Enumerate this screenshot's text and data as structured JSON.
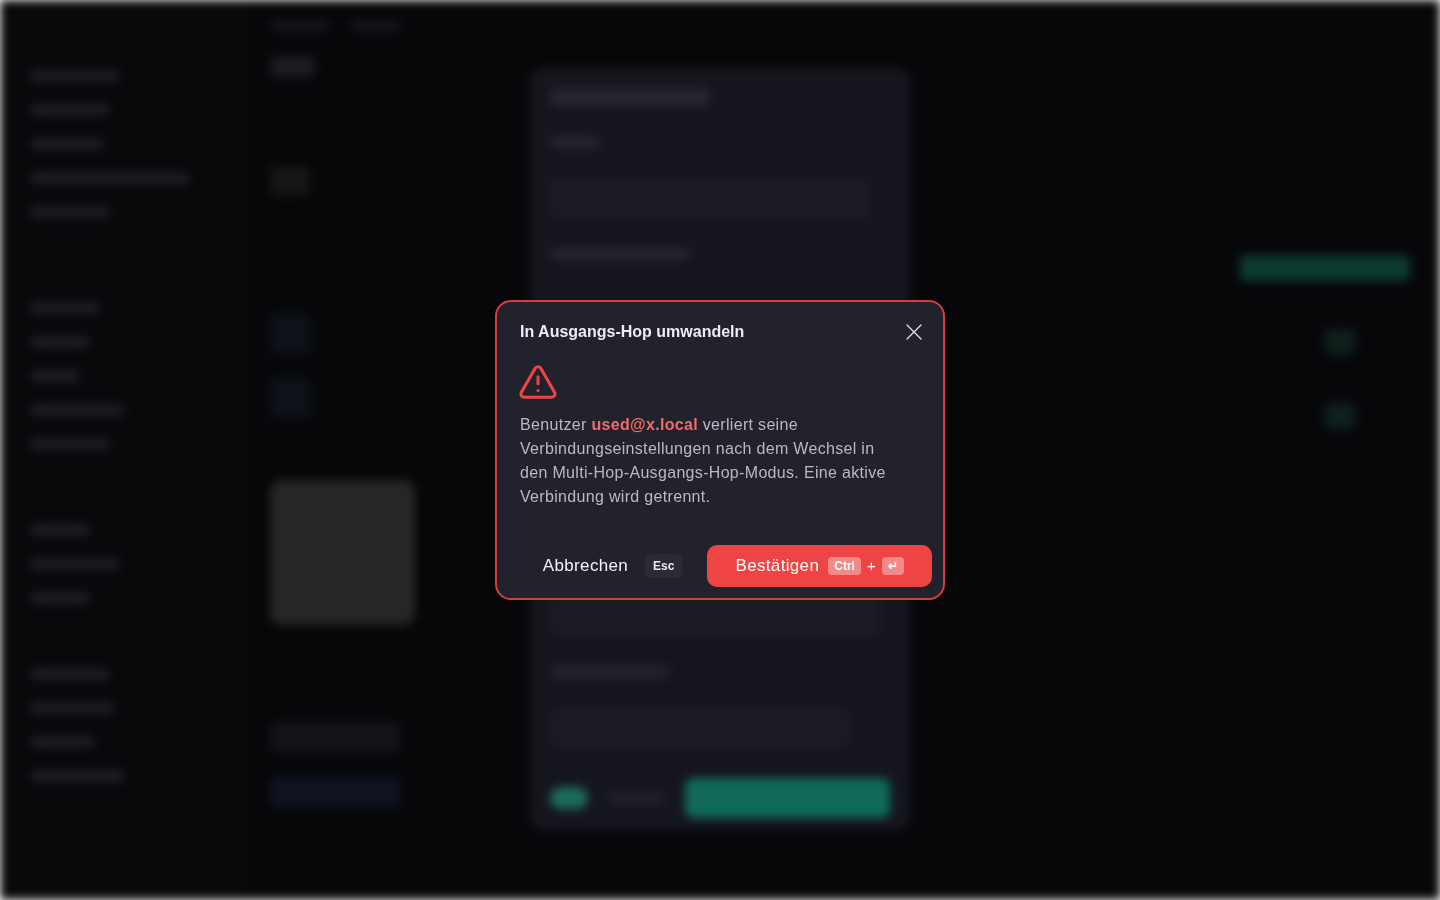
{
  "dialog": {
    "title": "In Ausgangs-Hop umwandeln",
    "message": "Benutzer **used@x.local** verliert seine Verbindungseinstellungen nach dem Wechsel in den Multi-Hop-Ausgangs-Hop-Modus. Eine aktive Verbindung wird getrennt.",
    "buttons": [
      {
        "kind": "cancel",
        "label": "Abbrechen",
        "shortcut": [
          "Esc"
        ]
      },
      {
        "kind": "confirm",
        "label": "Bestätigen",
        "shortcut": [
          "Ctrl",
          "↵"
        ],
        "shortcut_joiner": "+"
      }
    ]
  }
}
